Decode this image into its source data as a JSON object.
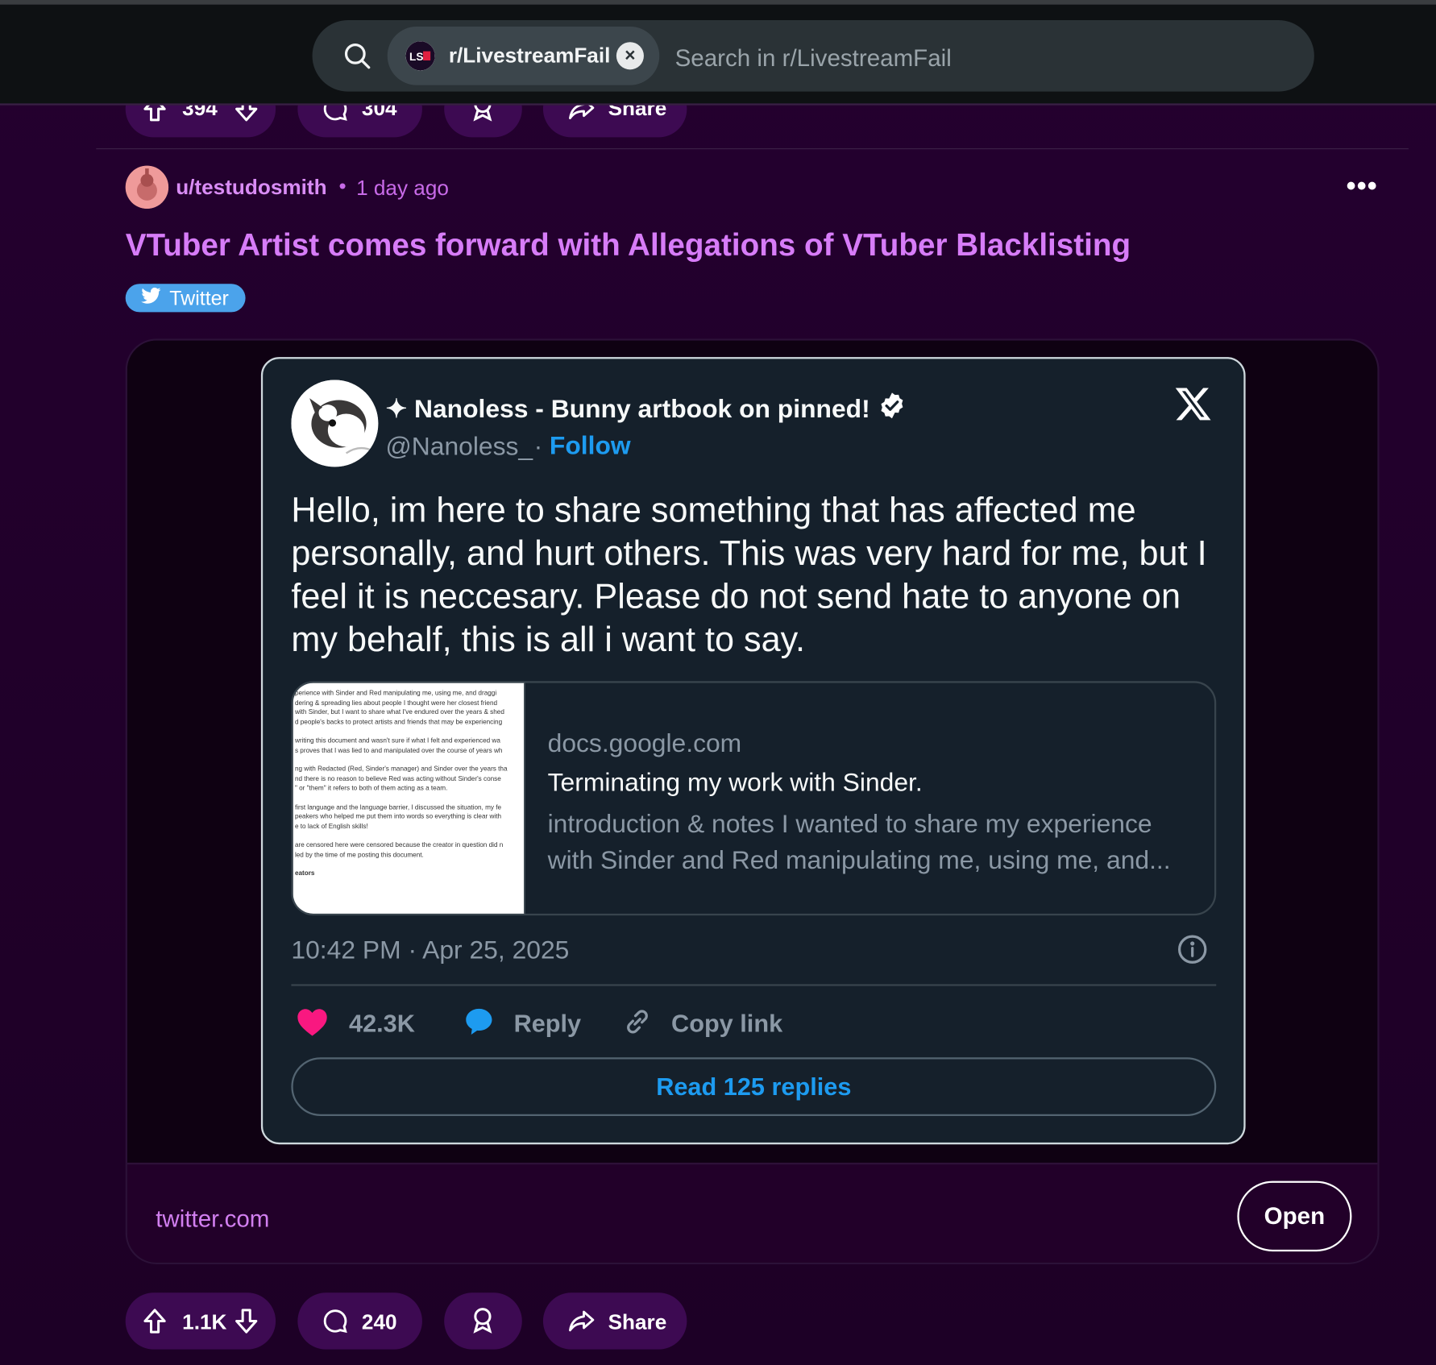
{
  "header": {
    "community_chip_label": "r/LivestreamFail",
    "search_placeholder": "Search in r/LivestreamFail",
    "chip_close_symbol": "×"
  },
  "previous_post": {
    "upvotes": "394",
    "comments": "304",
    "share_label": "Share"
  },
  "post": {
    "author": "u/testudosmith",
    "separator": "•",
    "age": "1 day ago",
    "overflow_label": "•••",
    "title": "VTuber Artist comes forward with Allegations of VTuber Blacklisting",
    "flair": "Twitter",
    "upvotes": "1.1K",
    "comments": "240",
    "share_label": "Share"
  },
  "embed": {
    "domain": "twitter.com",
    "open_label": "Open"
  },
  "tweet": {
    "display_name": "✦ Nanoless - Bunny artbook on pinned!",
    "handle": "@Nanoless_",
    "separator": "·",
    "follow_label": "Follow",
    "body": "Hello, im here to share something that has affected me personally, and hurt others. This was very hard for me, but I feel it is neccesary. Please do not send hate to anyone on my behalf, this is all i want to say.",
    "link_card": {
      "domain": "docs.google.com",
      "title": "Terminating my work with Sinder.",
      "description": "introduction & notes I wanted to share my experience with Sinder and Red manipulating me, using me, and...",
      "thumbnail_lines": [
        "perience with Sinder and Red manipulating me, using me, and draggi",
        "dering & spreading lies about people I thought were her closest friend",
        "with Sinder, but I want to share what I've endured over the years & shed",
        "d people's backs to protect artists and friends that may be experiencing",
        "",
        "writing this document and wasn't sure if what I felt and experienced wa",
        "s proves that I was lied to and manipulated over the course of years wh",
        "",
        "ng with Redacted (Red, Sinder's manager) and Sinder over the years tha",
        "nd there is no reason to believe Red was acting without Sinder's conse",
        "\" or \"them\" it refers to both of them acting as a team.",
        "",
        "first language and the language barrier, I discussed the situation, my fe",
        "peakers who helped me put them into words so everything is clear with",
        "e to lack of English skills!",
        "",
        " are censored here were censored because the creator in question did n",
        "led by the time of me posting this document.",
        "",
        "eators"
      ]
    },
    "timestamp": "10:42 PM · Apr 25, 2025",
    "likes": "42.3K",
    "reply_label": "Reply",
    "copy_link_label": "Copy link",
    "read_replies_label": "Read 125 replies"
  },
  "icons": {
    "search": "search-icon",
    "upvote": "upvote-icon",
    "downvote": "downvote-icon",
    "comment": "comment-icon",
    "award": "award-icon",
    "share": "share-icon",
    "twitter_bird": "twitter-bird-icon",
    "x_logo": "x-logo-icon",
    "verified": "verified-badge-icon",
    "heart": "heart-icon",
    "reply_bubble": "reply-icon",
    "link": "link-icon",
    "info": "info-icon"
  },
  "colors": {
    "page_background": "#22002c",
    "accent_purple": "#d77cf8",
    "pill_background": "#3d0a52",
    "twitter_blue": "#1d9bf0",
    "flair_blue": "#4ba3eb",
    "heart_pink": "#f91880",
    "tweet_background": "#15202b"
  }
}
